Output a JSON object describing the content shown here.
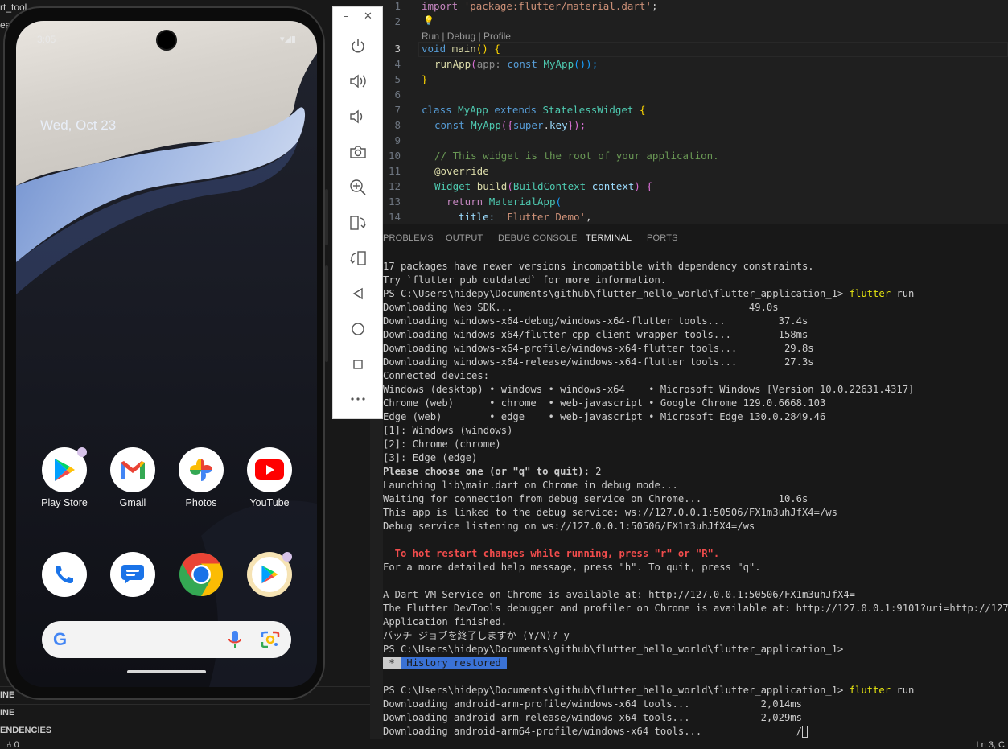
{
  "sidebar": {
    "top_label_1": "rt_tool",
    "top_label_2": "ea",
    "sections": [
      "INE",
      "INE",
      "ENDENCIES"
    ]
  },
  "status_bar": {
    "left": "⑃ 0",
    "right": "Ln 3, C"
  },
  "phone": {
    "time": "3:05",
    "status_icons": "▾◢▮",
    "date": "Wed, Oct 23",
    "apps_row1": [
      {
        "label": "Play Store",
        "icon": "play-store-icon"
      },
      {
        "label": "Gmail",
        "icon": "gmail-icon"
      },
      {
        "label": "Photos",
        "icon": "photos-icon"
      },
      {
        "label": "YouTube",
        "icon": "youtube-icon"
      }
    ],
    "dock": [
      {
        "icon": "phone-icon"
      },
      {
        "icon": "messages-icon"
      },
      {
        "icon": "chrome-icon"
      },
      {
        "icon": "play-games-icon"
      }
    ],
    "search_logo": "G"
  },
  "emulator_toolbar": {
    "buttons": [
      "power-icon",
      "volume-up-icon",
      "volume-down-icon",
      "camera-icon",
      "zoom-icon",
      "rotate-left-icon",
      "rotate-right-icon",
      "back-icon",
      "home-icon",
      "overview-icon",
      "more-icon"
    ],
    "minimize": "–",
    "close": "✕"
  },
  "editor": {
    "codelens": "Run | Debug | Profile",
    "line_numbers": [
      "1",
      "2",
      "3",
      "4",
      "5",
      "6",
      "7",
      "8",
      "9",
      "10",
      "11",
      "12",
      "13",
      "14"
    ],
    "lines": {
      "l1a": "import ",
      "l1b": "'package:flutter/material.dart'",
      "l1c": ";",
      "l2": "💡",
      "l3a": "void ",
      "l3b": "main",
      "l3c": "() {",
      "l4a": "runApp",
      "l4b": "(",
      "l4c": "app: ",
      "l4d": "const ",
      "l4e": "MyApp",
      "l4f": "());",
      "l5": "}",
      "l7a": "class ",
      "l7b": "MyApp ",
      "l7c": "extends ",
      "l7d": "StatelessWidget ",
      "l7e": "{",
      "l8a": "const ",
      "l8b": "MyApp",
      "l8c": "({",
      "l8d": "super",
      "l8e": ".",
      "l8f": "key",
      "l8g": "});",
      "l10": "// This widget is the root of your application.",
      "l11": "@override",
      "l12a": "Widget ",
      "l12b": "build",
      "l12c": "(",
      "l12d": "BuildContext ",
      "l12e": "context",
      "l12f": ") {",
      "l13a": "return ",
      "l13b": "MaterialApp",
      "l13c": "(",
      "l14a": "title: ",
      "l14b": "'Flutter Demo'",
      "l14c": ","
    }
  },
  "panel": {
    "tabs": [
      "PROBLEMS",
      "OUTPUT",
      "DEBUG CONSOLE",
      "TERMINAL",
      "PORTS"
    ],
    "active_tab": "TERMINAL"
  },
  "terminal": {
    "lines": [
      "17 packages have newer versions incompatible with dependency constraints.",
      "Try `flutter pub outdated` for more information.",
      "PS C:\\Users\\hidepy\\Documents\\github\\flutter_hello_world\\flutter_application_1> ",
      "Downloading Web SDK...                                        49.0s",
      "Downloading windows-x64-debug/windows-x64-flutter tools...         37.4s",
      "Downloading windows-x64/flutter-cpp-client-wrapper tools...        158ms",
      "Downloading windows-x64-profile/windows-x64-flutter tools...        29.8s",
      "Downloading windows-x64-release/windows-x64-flutter tools...        27.3s",
      "Connected devices:",
      "Windows (desktop) • windows • windows-x64    • Microsoft Windows [Version 10.0.22631.4317]",
      "Chrome (web)      • chrome  • web-javascript • Google Chrome 129.0.6668.103",
      "Edge (web)        • edge    • web-javascript • Microsoft Edge 130.0.2849.46",
      "[1]: Windows (windows)",
      "[2]: Chrome (chrome)",
      "[3]: Edge (edge)",
      "Please choose one (or \"q\" to quit): ",
      "Launching lib\\main.dart on Chrome in debug mode...",
      "Waiting for connection from debug service on Chrome...             10.6s",
      "This app is linked to the debug service: ws://127.0.0.1:50506/FX1m3uhJfX4=/ws",
      "Debug service listening on ws://127.0.0.1:50506/FX1m3uhJfX4=/ws",
      "",
      "  To hot restart changes while running, press \"r\" or \"R\".",
      "For a more detailed help message, press \"h\". To quit, press \"q\".",
      "",
      "A Dart VM Service on Chrome is available at: http://127.0.0.1:50506/FX1m3uhJfX4=",
      "The Flutter DevTools debugger and profiler on Chrome is available at: http://127.0.0.1:9101?uri=http://127.0.0.",
      "Application finished.",
      "バッチ ジョブを終了しますか (Y/N)? y",
      "PS C:\\Users\\hidepy\\Documents\\github\\flutter_hello_world\\flutter_application_1>",
      "",
      "",
      "PS C:\\Users\\hidepy\\Documents\\github\\flutter_hello_world\\flutter_application_1> ",
      "Downloading android-arm-profile/windows-x64 tools...            2,014ms",
      "Downloading android-arm-release/windows-x64 tools...            2,029ms",
      "Downloading android-arm64-profile/windows-x64 tools...                /"
    ],
    "cmd_flutter": "flutter",
    "cmd_run": " run",
    "choice_answer": "2",
    "history_star": " * ",
    "history_text": " History restored "
  }
}
